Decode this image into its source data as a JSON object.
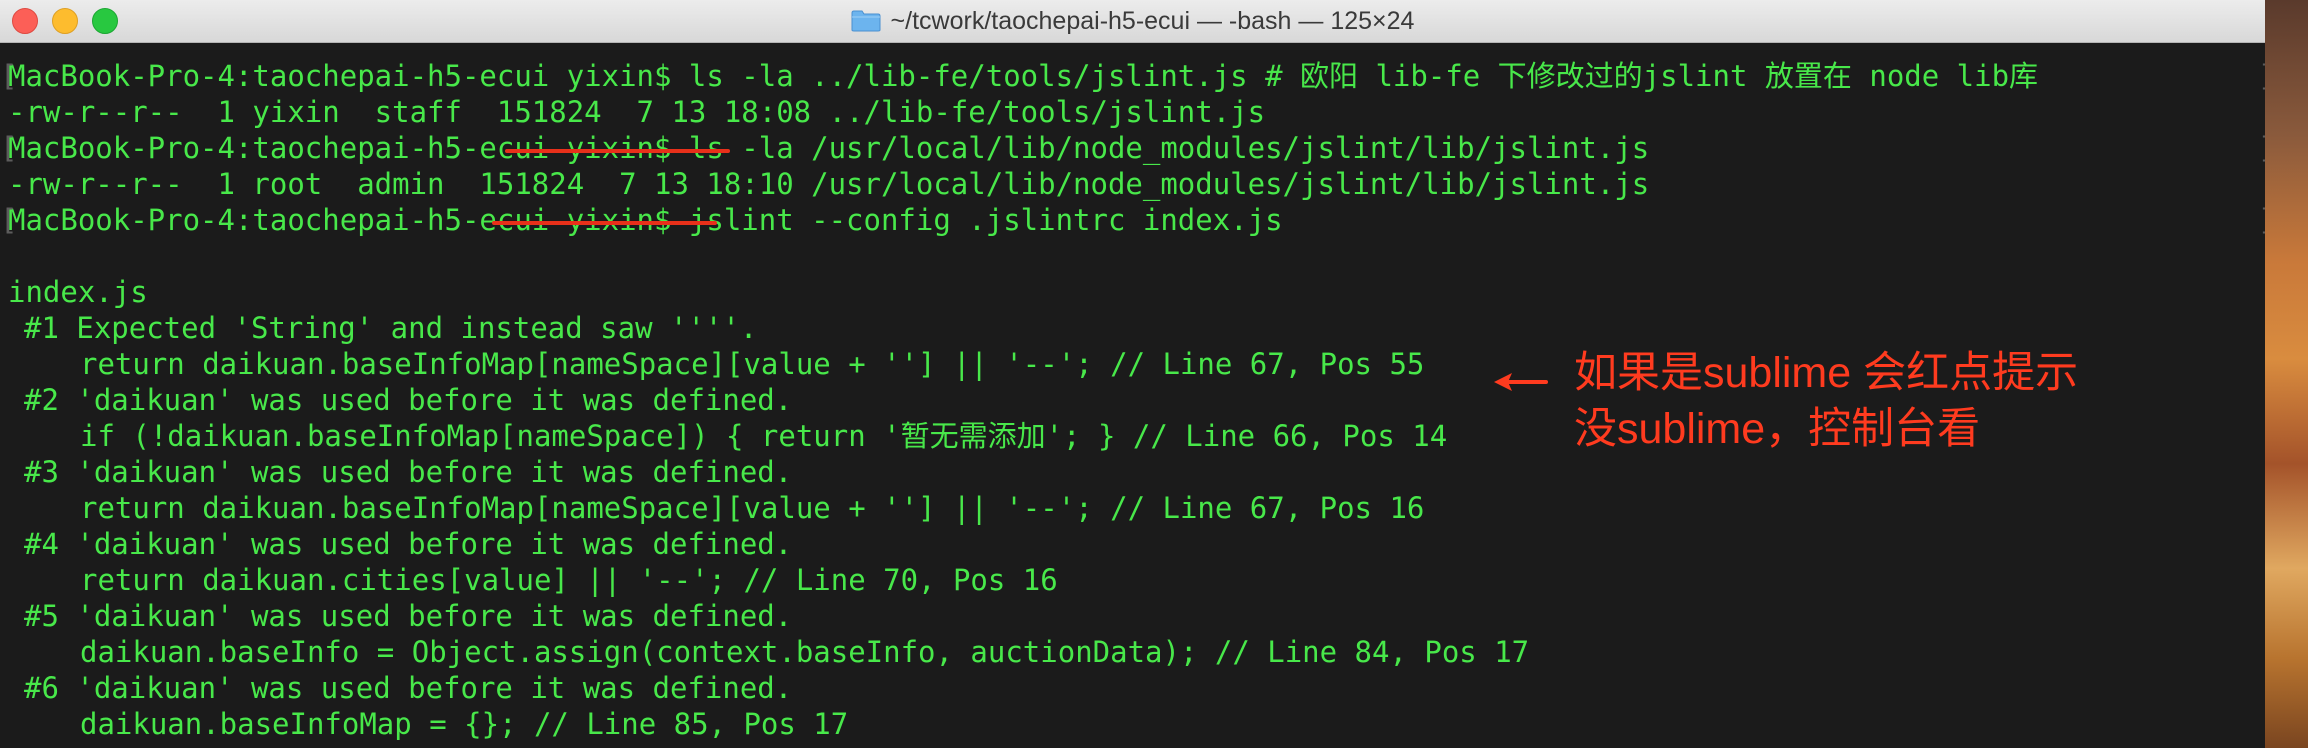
{
  "window": {
    "title": "~/tcwork/taochepai-h5-ecui — -bash — 125×24",
    "folder_icon": "folder-icon",
    "controls": {
      "close": "close-button",
      "minimize": "minimize-button",
      "zoom": "zoom-button"
    }
  },
  "terminal": {
    "lines": [
      {
        "kind": "prompt",
        "text": "MacBook-Pro-4:taochepai-h5-ecui yixin$ ls -la ../lib-fe/tools/jslint.js # 欧阳 lib-fe 下修改过的jslint 放置在 node lib库"
      },
      {
        "kind": "output",
        "text": "-rw-r--r--  1 yixin  staff  151824  7 13 18:08 ../lib-fe/tools/jslint.js"
      },
      {
        "kind": "prompt",
        "text": "MacBook-Pro-4:taochepai-h5-ecui yixin$ ls -la /usr/local/lib/node_modules/jslint/lib/jslint.js"
      },
      {
        "kind": "output",
        "text": "-rw-r--r--  1 root  admin  151824  7 13 18:10 /usr/local/lib/node_modules/jslint/lib/jslint.js"
      },
      {
        "kind": "prompt",
        "text": "MacBook-Pro-4:taochepai-h5-ecui yixin$ jslint --config .jslintrc index.js"
      },
      {
        "kind": "blank",
        "text": ""
      },
      {
        "kind": "output",
        "text": "index.js"
      },
      {
        "kind": "issue",
        "text": "#1 Expected 'String' and instead saw ''''."
      },
      {
        "kind": "code",
        "text": "return daikuan.baseInfoMap[nameSpace][value + ''] || '--'; // Line 67, Pos 55"
      },
      {
        "kind": "issue",
        "text": "#2 'daikuan' was used before it was defined."
      },
      {
        "kind": "code",
        "text": "if (!daikuan.baseInfoMap[nameSpace]) { return '暂无需添加'; } // Line 66, Pos 14"
      },
      {
        "kind": "issue",
        "text": "#3 'daikuan' was used before it was defined."
      },
      {
        "kind": "code",
        "text": "return daikuan.baseInfoMap[nameSpace][value + ''] || '--'; // Line 67, Pos 16"
      },
      {
        "kind": "issue",
        "text": "#4 'daikuan' was used before it was defined."
      },
      {
        "kind": "code",
        "text": "return daikuan.cities[value] || '--'; // Line 70, Pos 16"
      },
      {
        "kind": "issue",
        "text": "#5 'daikuan' was used before it was defined."
      },
      {
        "kind": "code",
        "text": "daikuan.baseInfo = Object.assign(context.baseInfo, auctionData); // Line 84, Pos 17"
      },
      {
        "kind": "issue",
        "text": "#6 'daikuan' was used before it was defined."
      },
      {
        "kind": "code",
        "text": "daikuan.baseInfoMap = {}; // Line 85, Pos 17"
      }
    ],
    "colors": {
      "text": "#48e84a",
      "background": "#1b1b1b",
      "annotation": "#ff3b1f"
    }
  },
  "annotation": {
    "line1": "如果是sublime 会红点提示",
    "line2": "没sublime，控制台看",
    "arrow_icon": "arrow-left-icon"
  }
}
